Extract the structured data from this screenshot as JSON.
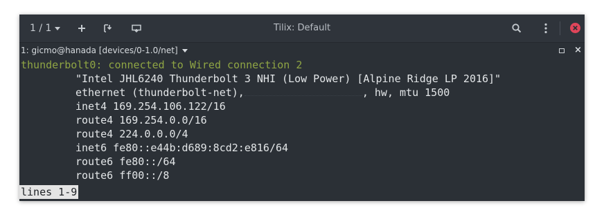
{
  "titlebar": {
    "session_label": "1 / 1",
    "window_title": "Tilix: Default"
  },
  "terminal_header": {
    "title": "1: gicmo@hanada [devices/0-1.0/net]"
  },
  "terminal": {
    "header_line": "thunderbolt0: connected to Wired connection 2",
    "lines": [
      "\"Intel JHL6240 Thunderbolt 3 NHI (Low Power) [Alpine Ridge LP 2016]\"",
      "ethernet (thunderbolt-net),",
      "inet4 169.254.106.122/16",
      "route4 169.254.0.0/16",
      "route4 224.0.0.0/4",
      "inet6 fe80::e44b:d689:8cd2:e816/64",
      "route6 fe80::/64",
      "route6 ff00::/8"
    ],
    "ethernet_suffix": ", hw, mtu 1500",
    "pager_status": "lines 1-9"
  },
  "colors": {
    "window_bg": "#2b3036",
    "header_text": "#8fa544",
    "close_button": "#e0455a",
    "pager_bg": "#e4e4e4"
  },
  "icons": {
    "add": "plus-icon",
    "split": "split-horizontal-icon",
    "sidebar": "session-sidebar-icon",
    "search": "search-icon",
    "menu": "kebab-menu-icon",
    "close": "close-icon"
  }
}
